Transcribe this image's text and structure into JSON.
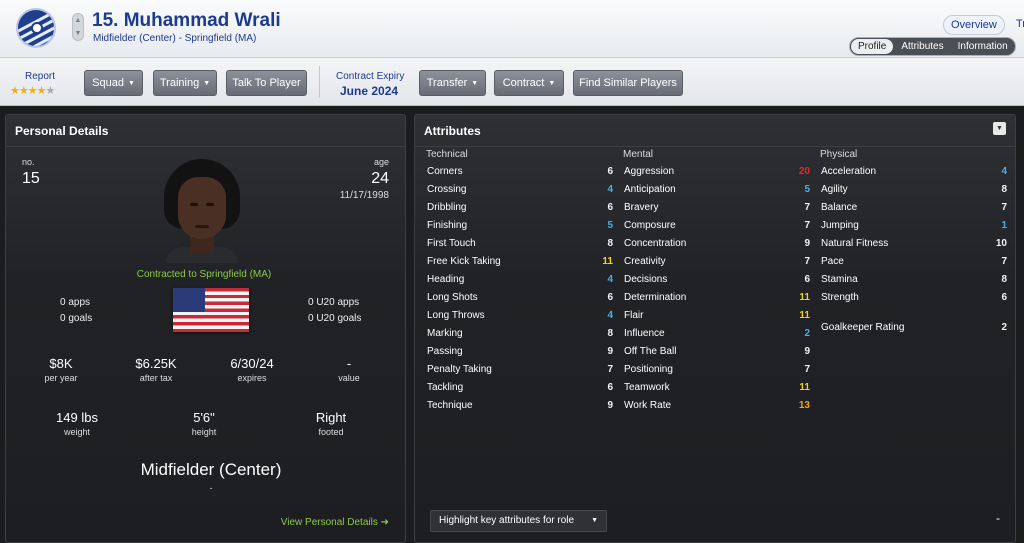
{
  "header": {
    "player_name": "15. Muhammad Wrali",
    "player_sub": "Midfielder (Center) - Springfield (MA)",
    "nav_overview": "Overview",
    "nav_cut": "Tr",
    "subtabs": [
      "Profile",
      "Attributes",
      "Information"
    ]
  },
  "toolbar": {
    "report_label": "Report",
    "stars": {
      "filled": 4,
      "total": 5
    },
    "buttons": {
      "squad": "Squad",
      "training": "Training",
      "talk": "Talk To Player",
      "transfer": "Transfer",
      "contract": "Contract",
      "similar": "Find Similar Players"
    },
    "contract_expiry_label": "Contract Expiry",
    "contract_expiry_value": "June 2024"
  },
  "personal": {
    "title": "Personal Details",
    "no_label": "no.",
    "no": "15",
    "age_label": "age",
    "age": "24",
    "dob": "11/17/1998",
    "contracted": "Contracted to Springfield (MA)",
    "apps": "0 apps",
    "goals": "0 goals",
    "u20_apps": "0 U20 apps",
    "u20_goals": "0 U20 goals",
    "wage": "$8K",
    "wage_label": "per year",
    "after_tax": "$6.25K",
    "after_tax_label": "after tax",
    "expires": "6/30/24",
    "expires_label": "expires",
    "value": "-",
    "value_label": "value",
    "weight": "149 lbs",
    "weight_label": "weight",
    "height": "5'6\"",
    "height_label": "height",
    "foot": "Right",
    "foot_label": "footed",
    "position": "Midfielder (Center)",
    "position_dash": "-",
    "view_link": "View Personal Details ➜"
  },
  "attributes": {
    "title": "Attributes",
    "technical_label": "Technical",
    "mental_label": "Mental",
    "physical_label": "Physical",
    "technical": [
      {
        "name": "Corners",
        "value": "6",
        "tone": "white"
      },
      {
        "name": "Crossing",
        "value": "4",
        "tone": "blue"
      },
      {
        "name": "Dribbling",
        "value": "6",
        "tone": "white"
      },
      {
        "name": "Finishing",
        "value": "5",
        "tone": "blue"
      },
      {
        "name": "First Touch",
        "value": "8",
        "tone": "white"
      },
      {
        "name": "Free Kick Taking",
        "value": "11",
        "tone": "yellow"
      },
      {
        "name": "Heading",
        "value": "4",
        "tone": "blue"
      },
      {
        "name": "Long Shots",
        "value": "6",
        "tone": "white"
      },
      {
        "name": "Long Throws",
        "value": "4",
        "tone": "blue"
      },
      {
        "name": "Marking",
        "value": "8",
        "tone": "white"
      },
      {
        "name": "Passing",
        "value": "9",
        "tone": "white"
      },
      {
        "name": "Penalty Taking",
        "value": "7",
        "tone": "white"
      },
      {
        "name": "Tackling",
        "value": "6",
        "tone": "white"
      },
      {
        "name": "Technique",
        "value": "9",
        "tone": "white"
      }
    ],
    "mental": [
      {
        "name": "Aggression",
        "value": "20",
        "tone": "red"
      },
      {
        "name": "Anticipation",
        "value": "5",
        "tone": "blue"
      },
      {
        "name": "Bravery",
        "value": "7",
        "tone": "white"
      },
      {
        "name": "Composure",
        "value": "7",
        "tone": "white"
      },
      {
        "name": "Concentration",
        "value": "9",
        "tone": "white"
      },
      {
        "name": "Creativity",
        "value": "7",
        "tone": "white"
      },
      {
        "name": "Decisions",
        "value": "6",
        "tone": "white"
      },
      {
        "name": "Determination",
        "value": "11",
        "tone": "yellow"
      },
      {
        "name": "Flair",
        "value": "11",
        "tone": "yellow"
      },
      {
        "name": "Influence",
        "value": "2",
        "tone": "blue"
      },
      {
        "name": "Off The Ball",
        "value": "9",
        "tone": "white"
      },
      {
        "name": "Positioning",
        "value": "7",
        "tone": "white"
      },
      {
        "name": "Teamwork",
        "value": "11",
        "tone": "yellow"
      },
      {
        "name": "Work Rate",
        "value": "13",
        "tone": "orange"
      }
    ],
    "physical": [
      {
        "name": "Acceleration",
        "value": "4",
        "tone": "blue"
      },
      {
        "name": "Agility",
        "value": "8",
        "tone": "white"
      },
      {
        "name": "Balance",
        "value": "7",
        "tone": "white"
      },
      {
        "name": "Jumping",
        "value": "1",
        "tone": "blue"
      },
      {
        "name": "Natural Fitness",
        "value": "10",
        "tone": "white"
      },
      {
        "name": "Pace",
        "value": "7",
        "tone": "white"
      },
      {
        "name": "Stamina",
        "value": "8",
        "tone": "white"
      },
      {
        "name": "Strength",
        "value": "6",
        "tone": "white"
      }
    ],
    "goalkeeper_rating_label": "Goalkeeper Rating",
    "goalkeeper_rating": "2",
    "highlight_dropdown": "Highlight key attributes for role",
    "minus": "-"
  },
  "colors": {
    "accent_blue": "#1c3a8f",
    "value_blue": "#4ab0ec",
    "value_yellow": "#f2d21a",
    "value_orange": "#f2a61a",
    "value_red": "#e02b2b",
    "green_text": "#8cc84a"
  }
}
